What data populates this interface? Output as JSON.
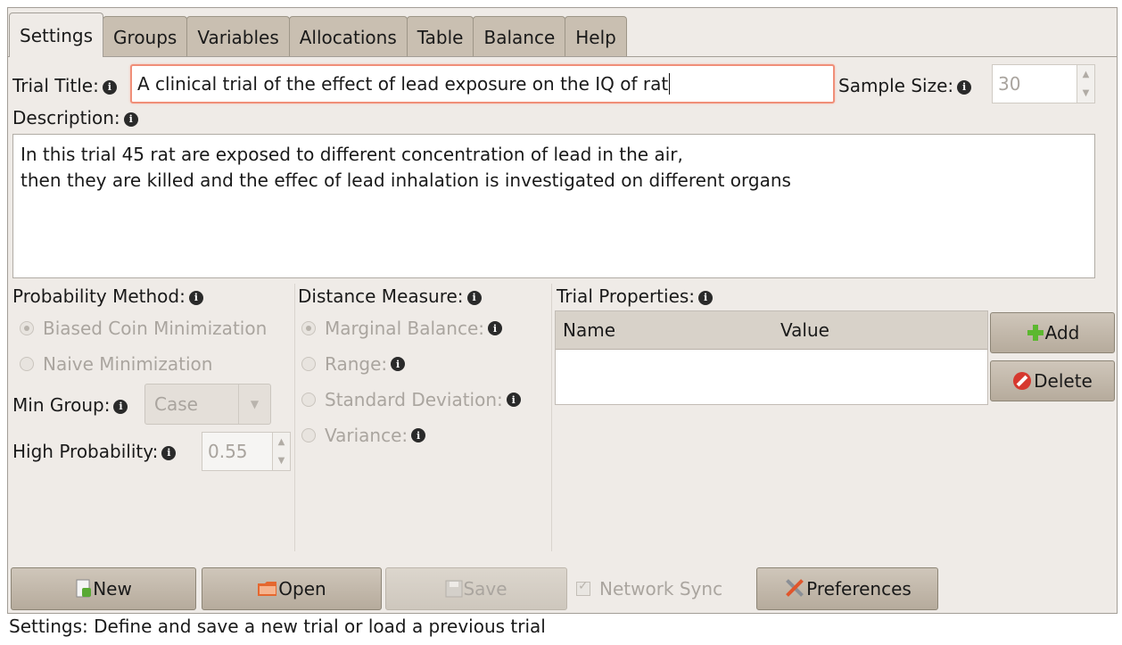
{
  "tabs": [
    "Settings",
    "Groups",
    "Variables",
    "Allocations",
    "Table",
    "Balance",
    "Help"
  ],
  "trial_title": {
    "label": "Trial Title:",
    "value": "A clinical trial of the effect of lead exposure on the IQ of rat"
  },
  "sample_size": {
    "label": "Sample Size:",
    "value": "30"
  },
  "description": {
    "label": "Description:",
    "line1": "In this trial 45 rat are exposed to different concentration of lead in the air,",
    "line2": "then they are killed and the effec of lead inhalation is investigated on different organs"
  },
  "probability": {
    "label": "Probability Method:",
    "options": [
      "Biased Coin Minimization",
      "Naive Minimization"
    ],
    "min_group_label": "Min Group:",
    "min_group_value": "Case",
    "high_prob_label": "High Probability:",
    "high_prob_value": "0.55"
  },
  "distance": {
    "label": "Distance Measure:",
    "options": [
      "Marginal Balance:",
      "Range:",
      "Standard Deviation:",
      "Variance:"
    ]
  },
  "trial_properties": {
    "label": "Trial Properties:",
    "columns": [
      "Name",
      "Value"
    ],
    "add_label": "Add",
    "delete_label": "Delete"
  },
  "toolbar": {
    "new_label": "New",
    "open_label": "Open",
    "save_label": "Save",
    "network_sync_label": "Network Sync",
    "preferences_label": "Preferences"
  },
  "status": "Settings: Define and save a new trial or load a previous trial",
  "icon_names": [
    "info-icon",
    "add-icon",
    "delete-icon",
    "new-file-icon",
    "open-folder-icon",
    "save-icon",
    "preferences-icon"
  ]
}
